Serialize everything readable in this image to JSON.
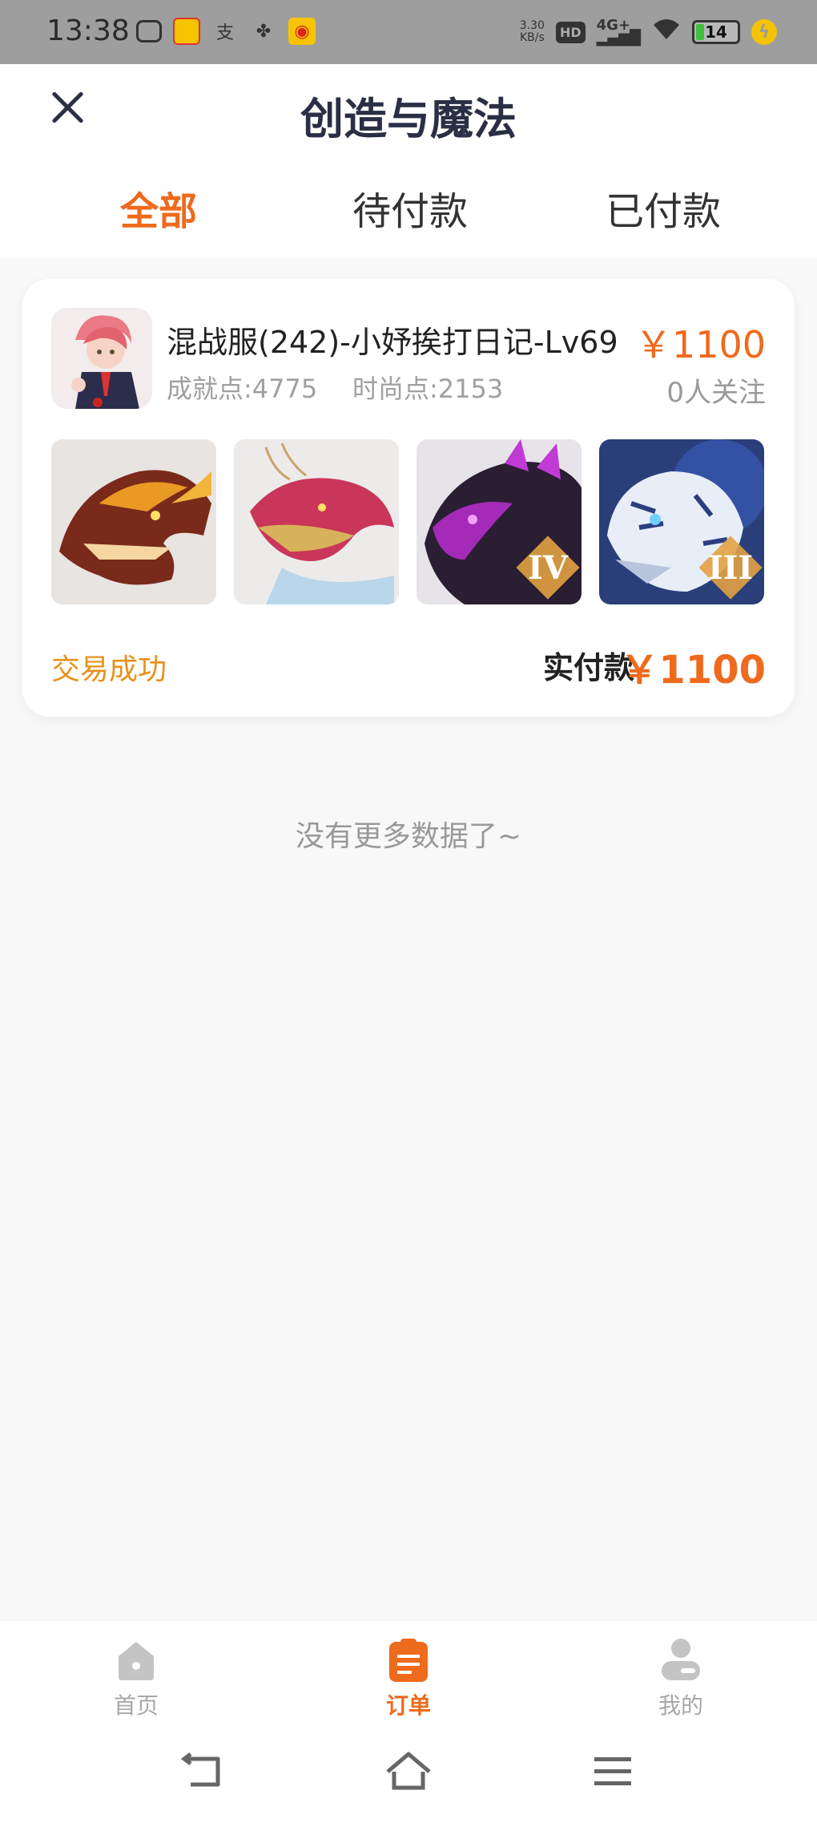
{
  "status_bar": {
    "time": "13:38",
    "net_speed_value": "3.30",
    "net_speed_unit": "KB/s",
    "hd": "HD",
    "signal": "4G+",
    "battery": "14"
  },
  "header": {
    "title": "创造与魔法",
    "tabs": [
      {
        "label": "全部",
        "active": true
      },
      {
        "label": "待付款",
        "active": false
      },
      {
        "label": "已付款",
        "active": false
      }
    ]
  },
  "order": {
    "title": "混战服(242)-小妤挨打日记-Lv69",
    "achievement": "成就点:4775",
    "fashion": "时尚点:2153",
    "price": "￥1100",
    "followers": "0人关注",
    "thumbnails": [
      {
        "icon": "fire-dragon-mount-icon",
        "tier": ""
      },
      {
        "icon": "eastern-dragon-mount-icon",
        "tier": ""
      },
      {
        "icon": "purple-beast-mount-icon",
        "tier": "IV"
      },
      {
        "icon": "white-tiger-mount-icon",
        "tier": "III"
      }
    ],
    "status": "交易成功",
    "paid_label": "实付款",
    "paid_amount": "￥1100"
  },
  "list_end_text": "没有更多数据了~",
  "bottom_nav": {
    "items": [
      {
        "label": "首页",
        "icon": "home-icon",
        "active": false
      },
      {
        "label": "订单",
        "icon": "orders-icon",
        "active": true
      },
      {
        "label": "我的",
        "icon": "profile-icon",
        "active": false
      }
    ]
  },
  "colors": {
    "accent": "#ee6a1c",
    "status_success": "#e6921c",
    "title": "#2b2f45"
  }
}
